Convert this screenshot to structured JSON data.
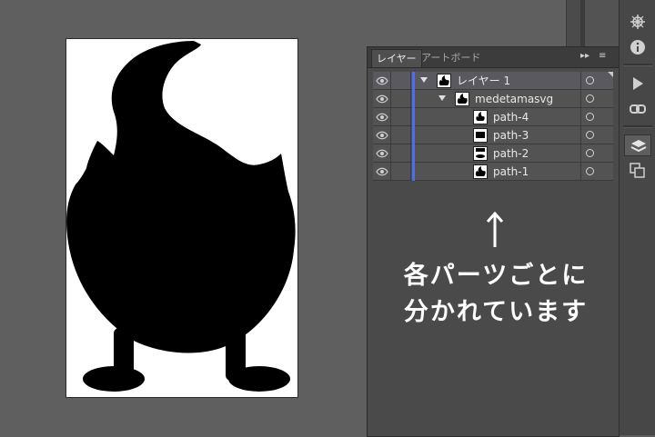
{
  "layers_panel": {
    "tabs": [
      {
        "label": "レイヤー",
        "active": true
      },
      {
        "label": "アートボード",
        "active": false
      }
    ],
    "collapse_glyph": "▸▸",
    "menu_glyph": "≡",
    "rows": [
      {
        "label": "レイヤー 1",
        "level": 0,
        "expanded": true
      },
      {
        "label": "medetamasvg",
        "level": 1,
        "expanded": true
      },
      {
        "label": "path-4",
        "level": 2
      },
      {
        "label": "path-3",
        "level": 2
      },
      {
        "label": "path-2",
        "level": 2
      },
      {
        "label": "path-1",
        "level": 2
      }
    ],
    "layer_color": "#4d6df0"
  },
  "annotation": {
    "arrow_glyph": "↑",
    "line1": "各パーツごとに",
    "line2": "分かれています"
  },
  "tool_strip": {
    "icons": [
      "compass-icon",
      "info-icon",
      "play-icon",
      "link-icon",
      "layers-icon",
      "artboards-icon"
    ]
  },
  "colors": {
    "canvas": "#5f5f5f",
    "panel": "#4a4a4a",
    "artwork": "#000000"
  }
}
